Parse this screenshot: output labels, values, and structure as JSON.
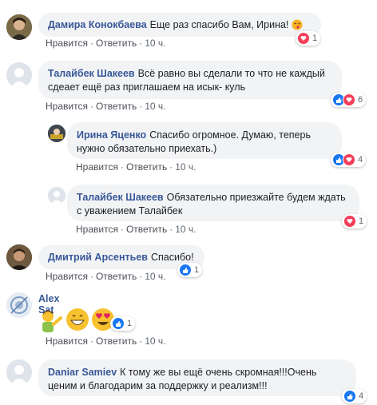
{
  "actions": {
    "like": "Нравится",
    "reply": "Ответить"
  },
  "colors": {
    "author": "#385898",
    "bubble": "#f2f3f5",
    "like": "#1877f2",
    "heart": "#f33e58"
  },
  "comments": [
    {
      "author": "Дамира Конокбаева",
      "text": "Еще раз спасибо Вам, Ирина!",
      "emoji": "kissing-wink-emoji",
      "time": "10 ч.",
      "reactions": [
        "heart"
      ],
      "count": "1"
    },
    {
      "author": "Талайбек Шакеев",
      "text": "Всё равно вы сделали то что не каждый сдеает ещё раз приглашаем на исык- куль",
      "time": "10 ч.",
      "reactions": [
        "like",
        "heart"
      ],
      "count": "6"
    },
    {
      "author": "Ирина Яценко",
      "text": "Спасибо огромное. Думаю, теперь нужно обязательно приехать.)",
      "time": "10 ч.",
      "reactions": [
        "like",
        "heart"
      ],
      "count": "4"
    },
    {
      "author": "Талайбек Шакеев",
      "text": "Обязательно приезжайте будем ждать с уважением Талайбек",
      "time": "10 ч.",
      "reactions": [
        "heart"
      ],
      "count": "1"
    },
    {
      "author": "Дмитрий Арсентьев",
      "text": "Спасибо!",
      "time": "10 ч.",
      "reactions": [
        "like"
      ],
      "count": "1"
    },
    {
      "author": "Alex Sat",
      "text": "",
      "emojis": [
        "person-tipping-hand-emoji",
        "grinning-face-emoji",
        "heart-eyes-emoji"
      ],
      "time": "10 ч.",
      "reactions": [
        "like"
      ],
      "count": "1"
    },
    {
      "author": "Daniar Samiev",
      "text": "К тому же вы ещё очень скромная!!!Очень ценим и благодарим за поддержку и реализм!!!",
      "time": "10 ч.",
      "reactions": [
        "like"
      ],
      "count": "4"
    }
  ]
}
